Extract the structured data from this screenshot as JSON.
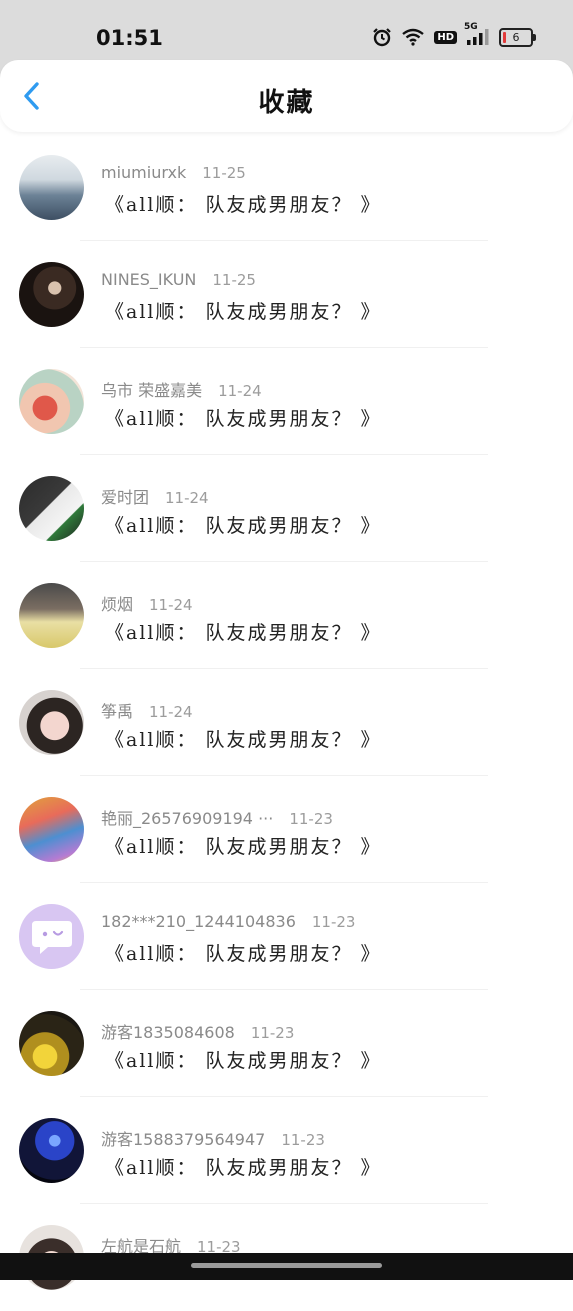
{
  "status": {
    "time": "01:51",
    "battery": "6",
    "network": "5G",
    "hd": "HD"
  },
  "header": {
    "title": "收藏"
  },
  "favorites": [
    {
      "user": "miumiurxk",
      "date": "11-25",
      "title": "《all顺： 队友成男朋友？ 》",
      "avatar": "sea-clouds-photo"
    },
    {
      "user": "NINES_IKUN",
      "date": "11-25",
      "title": "《all顺： 队友成男朋友？ 》",
      "avatar": "portrait-dark-photo"
    },
    {
      "user": "乌市 荣盛嘉美",
      "date": "11-24",
      "title": "《all顺： 队友成男朋友？ 》",
      "avatar": "flower-bouquet-photo"
    },
    {
      "user": "爱时团",
      "date": "11-24",
      "title": "《all顺： 队友成男朋友？ 》",
      "avatar": "person-mask-photo"
    },
    {
      "user": "烦烟",
      "date": "11-24",
      "title": "《all顺： 队友成男朋友？ 》",
      "avatar": "mirror-selfie-photo"
    },
    {
      "user": "筝禹",
      "date": "11-24",
      "title": "《all顺： 队友成男朋友？ 》",
      "avatar": "face-portrait-photo"
    },
    {
      "user": "艳丽_26576909194 ···",
      "date": "11-23",
      "title": "《all顺： 队友成男朋友？ 》",
      "avatar": "colorful-room-photo"
    },
    {
      "user": "182***210_1244104836",
      "date": "11-23",
      "title": "《all顺： 队友成男朋友？ 》",
      "avatar": "default-chat-avatar"
    },
    {
      "user": "游客1835084608",
      "date": "11-23",
      "title": "《all顺： 队友成男朋友？ 》",
      "avatar": "yellow-glow-photo"
    },
    {
      "user": "游客1588379564947",
      "date": "11-23",
      "title": "《all顺： 队友成男朋友？ 》",
      "avatar": "blue-lights-photo"
    },
    {
      "user": "左航是石航",
      "date": "11-23",
      "title": "",
      "avatar": "partial-portrait-photo"
    }
  ],
  "colors": {
    "accent": "#2f9bf0",
    "status_bar_bg": "#dcdcdc",
    "username": "#8a8a8a",
    "title_text": "#222222",
    "default_avatar_bg": "#d8c6f2"
  }
}
